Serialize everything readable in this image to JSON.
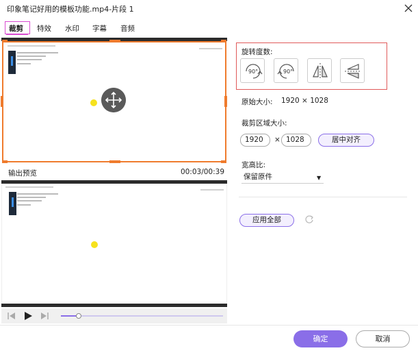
{
  "window": {
    "title": "印象笔记好用的模板功能.mp4-片段 1"
  },
  "tabs": [
    {
      "label": "裁剪",
      "active": true
    },
    {
      "label": "特效"
    },
    {
      "label": "水印"
    },
    {
      "label": "字幕"
    },
    {
      "label": "音频"
    }
  ],
  "preview": {
    "output_label": "输出预览",
    "time": "00:03/00:39",
    "progress_fraction": 0.11
  },
  "crop": {
    "rotation_label": "旋转度数:",
    "rotate_buttons": [
      {
        "icon": "rotate-cw-90-icon",
        "text": "90°"
      },
      {
        "icon": "rotate-ccw-90-icon",
        "text": "90°"
      },
      {
        "icon": "flip-horizontal-icon"
      },
      {
        "icon": "flip-vertical-icon"
      }
    ],
    "original_size_label": "原始大小:",
    "original_size_value": "1920 × 1028",
    "crop_area_label": "裁剪区域大小:",
    "width_value": "1920",
    "times_sign": "×",
    "height_value": "1028",
    "center_button": "居中对齐",
    "aspect_label": "宽高比:",
    "aspect_value": "保留原件",
    "apply_all_button": "应用全部"
  },
  "footer": {
    "ok_label": "确定",
    "cancel_label": "取消"
  },
  "colors": {
    "accent": "#8a6ee8",
    "crop_frame": "#ef7b2d",
    "highlight_box": "#e05a5a",
    "tab_highlight": "#d94bd1"
  }
}
